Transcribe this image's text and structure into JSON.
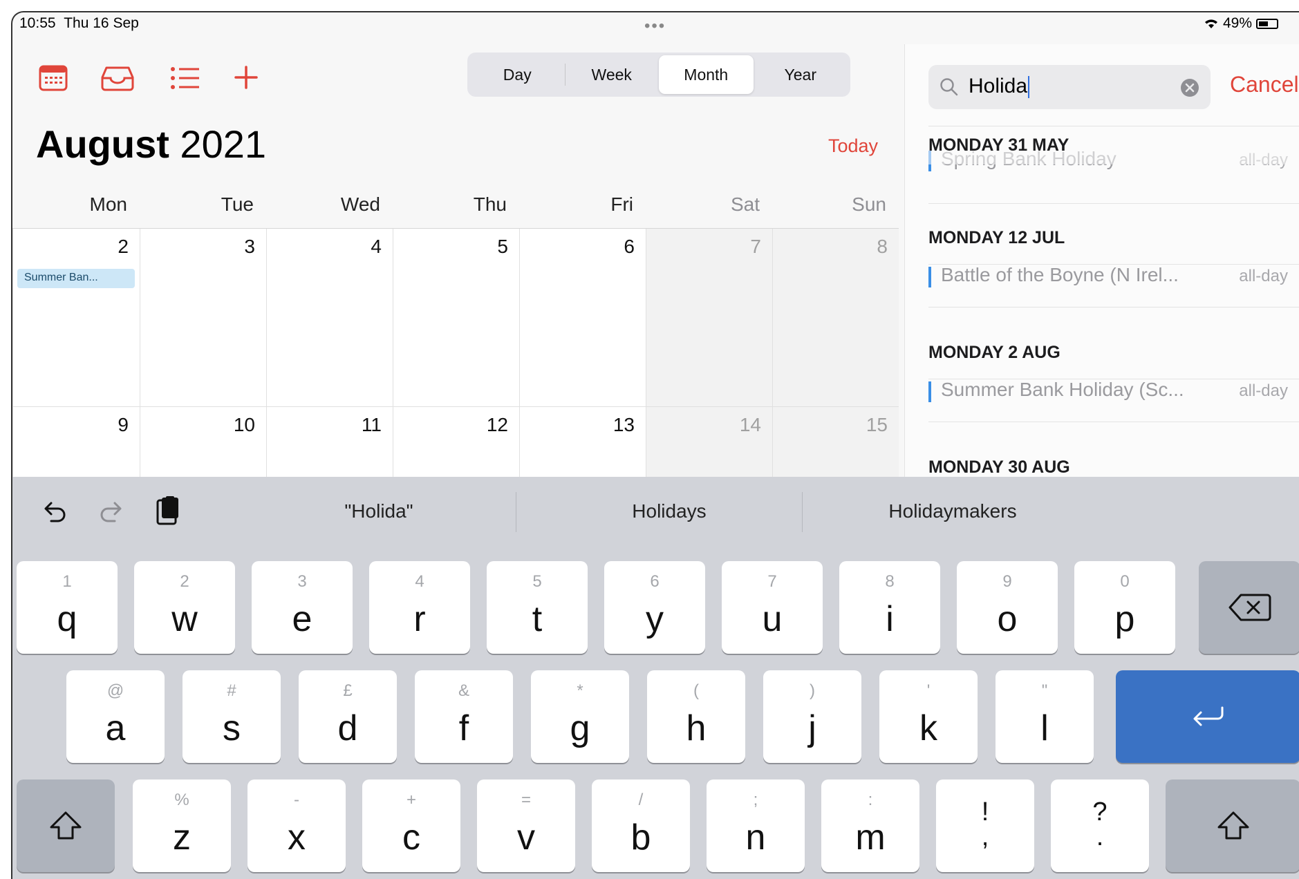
{
  "status_bar": {
    "time": "10:55",
    "date": "Thu 16 Sep",
    "battery": "49%"
  },
  "toolbar": {
    "segments": [
      {
        "label": "Day",
        "selected": false
      },
      {
        "label": "Week",
        "selected": false
      },
      {
        "label": "Month",
        "selected": true
      },
      {
        "label": "Year",
        "selected": false
      }
    ],
    "today_label": "Today"
  },
  "calendar": {
    "month": "August",
    "year": "2021",
    "weekdays": [
      "Mon",
      "Tue",
      "Wed",
      "Thu",
      "Fri",
      "Sat",
      "Sun"
    ],
    "weeks": [
      [
        "2",
        "3",
        "4",
        "5",
        "6",
        "7",
        "8"
      ],
      [
        "9",
        "10",
        "11",
        "12",
        "13",
        "14",
        "15"
      ]
    ],
    "event_chip": "Summer Ban..."
  },
  "search": {
    "query": "Holida",
    "cancel_label": "Cancel",
    "results": [
      {
        "date": "MONDAY 31 MAY",
        "title": "Spring Bank Holiday",
        "time": "all-day"
      },
      {
        "date": "MONDAY 12 JUL",
        "title": "Battle of the Boyne (N Irel...",
        "time": "all-day"
      },
      {
        "date": "MONDAY 2 AUG",
        "title": "Summer Bank Holiday (Sc...",
        "time": "all-day"
      },
      {
        "date": "MONDAY 30 AUG"
      }
    ]
  },
  "keyboard": {
    "suggestions": [
      "\"Holida\"",
      "Holidays",
      "Holidaymakers"
    ],
    "row1": [
      {
        "k": "q",
        "s": "1"
      },
      {
        "k": "w",
        "s": "2"
      },
      {
        "k": "e",
        "s": "3"
      },
      {
        "k": "r",
        "s": "4"
      },
      {
        "k": "t",
        "s": "5"
      },
      {
        "k": "y",
        "s": "6"
      },
      {
        "k": "u",
        "s": "7"
      },
      {
        "k": "i",
        "s": "8"
      },
      {
        "k": "o",
        "s": "9"
      },
      {
        "k": "p",
        "s": "0"
      }
    ],
    "row2": [
      {
        "k": "a",
        "s": "@"
      },
      {
        "k": "s",
        "s": "#"
      },
      {
        "k": "d",
        "s": "£"
      },
      {
        "k": "f",
        "s": "&"
      },
      {
        "k": "g",
        "s": "*"
      },
      {
        "k": "h",
        "s": "("
      },
      {
        "k": "j",
        "s": ")"
      },
      {
        "k": "k",
        "s": "'"
      },
      {
        "k": "l",
        "s": "\""
      }
    ],
    "row3": [
      {
        "k": "z",
        "s": "%"
      },
      {
        "k": "x",
        "s": "-"
      },
      {
        "k": "c",
        "s": "+"
      },
      {
        "k": "v",
        "s": "="
      },
      {
        "k": "b",
        "s": "/"
      },
      {
        "k": "n",
        "s": ";"
      },
      {
        "k": "m",
        "s": ":"
      }
    ],
    "punct": [
      {
        "top": "!",
        "bottom": ","
      },
      {
        "top": "?",
        "bottom": "."
      }
    ]
  }
}
